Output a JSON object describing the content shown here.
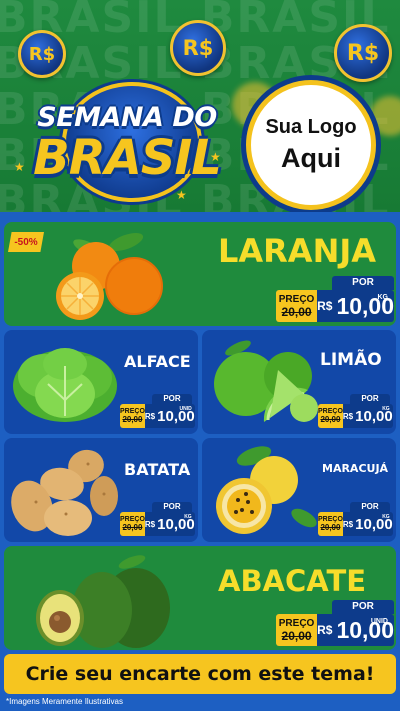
{
  "header": {
    "bg_word": "BRASIL BRASIL BRASIL BRASIL",
    "coin_text": "R$",
    "title_line1": "SEMANA DO",
    "title_line2": "BRASIL",
    "logo_line1": "Sua Logo",
    "logo_line2": "Aqui"
  },
  "discount_badge": "-50%",
  "price_labels": {
    "preco": "PREÇO",
    "por": "POR",
    "currency": "R$"
  },
  "products": [
    {
      "name": "LARANJA",
      "old_price": "20,00",
      "new_price": "10,00",
      "unit": "KG"
    },
    {
      "name": "ALFACE",
      "old_price": "20,00",
      "new_price": "10,00",
      "unit": "UNID"
    },
    {
      "name": "LIMÃO",
      "old_price": "20,00",
      "new_price": "10,00",
      "unit": "KG"
    },
    {
      "name": "BATATA",
      "old_price": "20,00",
      "new_price": "10,00",
      "unit": "KG"
    },
    {
      "name": "MARACUJÁ",
      "old_price": "20,00",
      "new_price": "10,00",
      "unit": "KG"
    },
    {
      "name": "ABACATE",
      "old_price": "20,00",
      "new_price": "10,00",
      "unit": "UNID"
    }
  ],
  "cta": "Crie seu encarte com este tema!",
  "footnote": "*Imagens Meramente Ilustrativas",
  "colors": {
    "green": "#1f8b3d",
    "blue": "#1248a8",
    "navy": "#0d3b8b",
    "yellow": "#f6c51f"
  }
}
